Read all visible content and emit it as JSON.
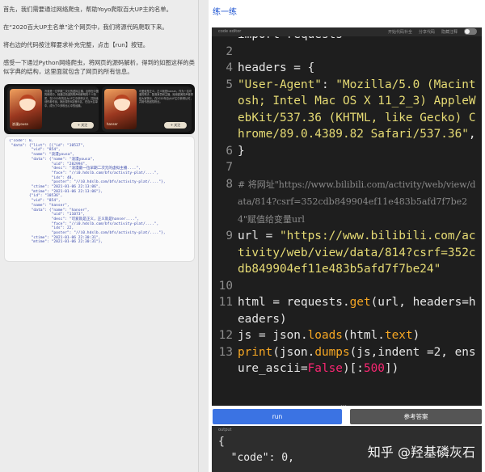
{
  "lesson": {
    "paragraphs": [
      "首先，我们需要通过网络爬虫，帮助Yoyo爬取百大UP主的名单。",
      "在“2020百大UP主名单”这个网页中，我们将源代码爬取下来。",
      "将右边的代码按注释要求补充完整，点击【run】按钮。",
      "感受一下通过Python网络爬虫，将网页的源码解析，得到的如图这样的类似字典的结构，这里面就包含了网页的所有信息。"
    ],
    "banner": {
      "cards": [
        {
          "tag": "浪漫yousa",
          "text": "冷漠是一位早期二次元的虚拟主播，出现在中国的网络中，她通过精湛的歌声和鲜明的个人特质，在2020年的百大UP主中获得认可，并持续创作着作品。她出现在B站音乐区，在百大名单中，成为了众多粉丝心中的经典。",
          "more": "+ 关注"
        },
        {
          "tag": "hanser",
          "text": "可爱就是正义，正义就是hanser。作为一名可爱的歌手、配音演员和主播，她用甜美的声音带给大家快乐，在2020年百大UP主中获得认可，并用作品回馈粉丝。",
          "more": "+ 关注"
        }
      ]
    },
    "json_preview": "{\"code\": 0,\n \"data\": {\"list\": [{\"id\": \"10537\",\n          \"vid\": \"854\",\n          \"name\": \"浪漫yousa\",\n          \"data\": {\"name\": \"浪漫yousa\",\n                   \"uid\": \"282994\",\n                   \"desc\": \"浪漫最一位早期二次元的虚拟主播....\",\n                   \"face\": \"//i0.hdslb.com/bfs/activity-plat/....\",\n                   \"ids\": 48,\n                   \"poster\": \"//i0.hdslb.com/bfs/activity-plat/....\"},\n          \"ctime\": \"2021-01-06 22:13:06\",\n          \"mtime\": \"2021-01-06 22:13:06\"},\n         {\"id\": \"10536\",\n          \"vid\": \"854\",\n          \"name\": \"hanser\",\n          \"data\": {\"name\": \"hanser\",\n                   \"uid\": \"11073\",\n                   \"desc\": \"可爱就是正义，正义就是hanser....\",\n                   \"face\": \"//i0.hdslb.com/bfs/activity-plat/....\",\n                   \"ids\": 22,\n                   \"poster\": \"//i0.hdslb.com/bfs/activity-plat/....\"},\n          \"ctime\": \"2021-01-06 22:30:31\",\n          \"mtime\": \"2021-01-06 22:30:31\"},"
  },
  "practice": {
    "title": "练一练",
    "editor_label": "code editor",
    "options": [
      "开始代码补全",
      "分享代码",
      "隐藏注释"
    ],
    "run_label": "run",
    "answer_label": "参考答案",
    "output_label": "output",
    "output_text": "{\n  \"code\": 0,"
  },
  "code_lines": [
    {
      "n": "",
      "html": "<span>import requests</span>"
    },
    {
      "n": "2",
      "html": ""
    },
    {
      "n": "4",
      "html": "headers = {"
    },
    {
      "n": "5",
      "html": "<span class=\"str\">\"User-Agent\"</span>: <span class=\"str\">\"Mozilla/5.0 (Macintosh; Intel Mac OS X 11_2_3) AppleWebKit/537.36 (KHTML, like Gecko) Chrome/89.0.4389.82 Safari/537.36\"</span>,"
    },
    {
      "n": "6",
      "html": "}"
    },
    {
      "n": "7",
      "html": ""
    },
    {
      "n": "8",
      "html": "<span class=\"cm\"># 将网址\"https://www.bilibili.com/activity/web/view/data/814?csrf=352cdb849904ef11e483b5afd7f7be24\"赋值给变量url</span>"
    },
    {
      "n": "9",
      "html": "url = <span class=\"str\">\"https://www.bilibili.com/activity/web/view/data/814?csrf=352cdb849904ef11e483b5afd7f7be24\"</span>"
    },
    {
      "n": "10",
      "html": ""
    },
    {
      "n": "11",
      "html": "html = requests.<span class=\"fn\">get</span>(url, headers=headers)"
    },
    {
      "n": "12",
      "html": "js = json.<span class=\"fn\">loads</span>(html.<span class=\"fn\">text</span>)"
    },
    {
      "n": "13",
      "html": "<span class=\"fn\">print</span>(json.<span class=\"fn\">dumps</span>(js,indent =2, ensure_ascii=<span class=\"kw\">False</span>)[:<span class=\"kw\">500</span>])"
    }
  ],
  "watermark": "知乎 @羟基磷灰石"
}
